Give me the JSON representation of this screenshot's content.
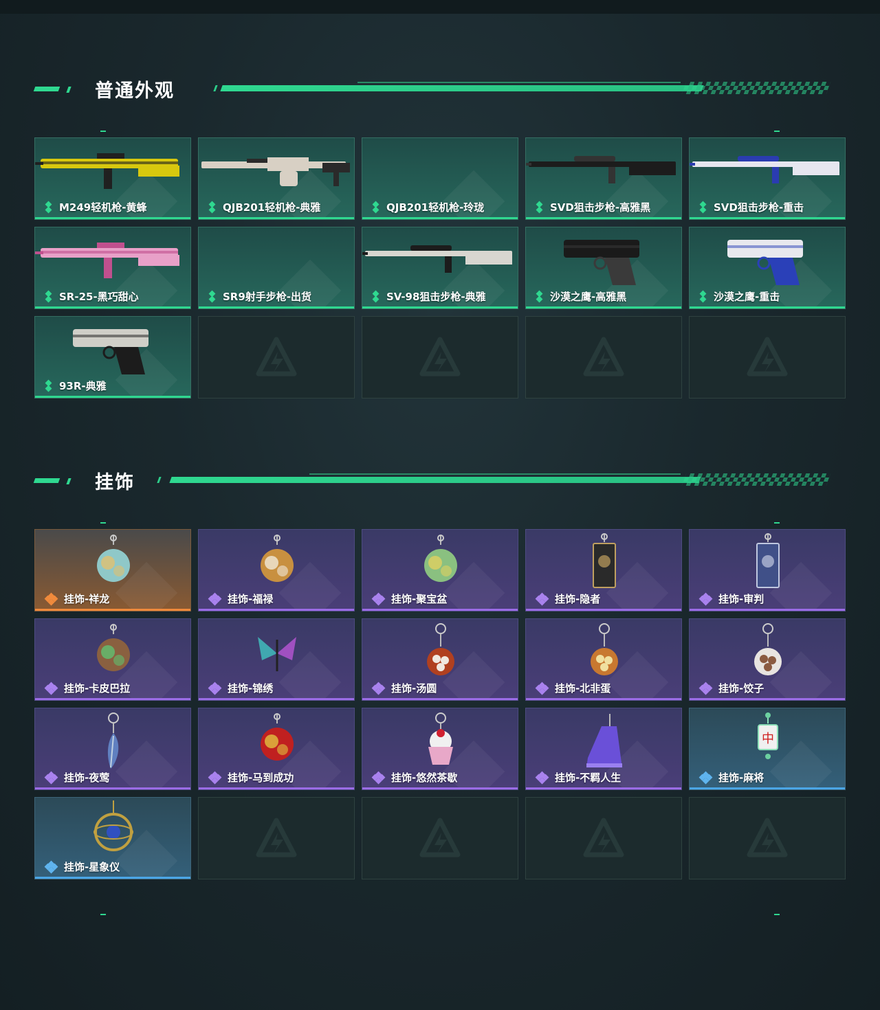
{
  "sections": [
    {
      "title": "普通外观",
      "items": [
        {
          "label": "M249轻机枪-黄蜂",
          "rarity": "green",
          "art": "rifle",
          "colors": [
            "#d8c80e",
            "#202020"
          ]
        },
        {
          "label": "QJB201轻机枪-典雅",
          "rarity": "green",
          "art": "lmg",
          "colors": [
            "#d8d0c4",
            "#2a2a2a"
          ]
        },
        {
          "label": "QJB201轻机枪-玲珑",
          "rarity": "green",
          "art": "none",
          "colors": []
        },
        {
          "label": "SVD狙击步枪-高雅黑",
          "rarity": "green",
          "art": "sniper",
          "colors": [
            "#1c1c1c",
            "#333333"
          ]
        },
        {
          "label": "SVD狙击步枪-重击",
          "rarity": "green",
          "art": "sniper",
          "colors": [
            "#e6e6ef",
            "#2a3cb0"
          ]
        },
        {
          "label": "SR-25-黑巧甜心",
          "rarity": "green",
          "art": "rifle",
          "colors": [
            "#e8a0c8",
            "#c0508e"
          ]
        },
        {
          "label": "SR9射手步枪-出货",
          "rarity": "green",
          "art": "none",
          "colors": []
        },
        {
          "label": "SV-98狙击步枪-典雅",
          "rarity": "green",
          "art": "sniper",
          "colors": [
            "#d8d6d0",
            "#1c1c1c"
          ]
        },
        {
          "label": "沙漠之鹰-高雅黑",
          "rarity": "green",
          "art": "pistol",
          "colors": [
            "#1a1a1a",
            "#3a3a3a"
          ]
        },
        {
          "label": "沙漠之鹰-重击",
          "rarity": "green",
          "art": "pistol",
          "colors": [
            "#e8e8ee",
            "#2a40b8"
          ]
        },
        {
          "label": "93R-典雅",
          "rarity": "green",
          "art": "pistol",
          "colors": [
            "#d0cfc8",
            "#1c1c1c"
          ]
        }
      ]
    },
    {
      "title": "挂饰",
      "items": [
        {
          "label": "挂饰-祥龙",
          "rarity": "orange",
          "art": "charm",
          "colors": [
            "#8fc8c8",
            "#e0c070"
          ]
        },
        {
          "label": "挂饰-福禄",
          "rarity": "purple",
          "art": "charm",
          "colors": [
            "#c89040",
            "#f0e8d8"
          ]
        },
        {
          "label": "挂饰-聚宝盆",
          "rarity": "purple",
          "art": "charm",
          "colors": [
            "#8ac080",
            "#e0d060"
          ]
        },
        {
          "label": "挂饰-隐者",
          "rarity": "purple",
          "art": "card",
          "colors": [
            "#2a2a2a",
            "#c0a060"
          ]
        },
        {
          "label": "挂饰-审判",
          "rarity": "purple",
          "art": "card",
          "colors": [
            "#405088",
            "#c0c8e0"
          ]
        },
        {
          "label": "挂饰-卡皮巴拉",
          "rarity": "purple",
          "art": "charm",
          "colors": [
            "#8a6040",
            "#60c070"
          ]
        },
        {
          "label": "挂饰-锦绣",
          "rarity": "purple",
          "art": "butterfly",
          "colors": [
            "#40a8b0",
            "#a050c0"
          ]
        },
        {
          "label": "挂饰-汤圆",
          "rarity": "purple",
          "art": "bowl",
          "colors": [
            "#b04020",
            "#f0e8e0"
          ]
        },
        {
          "label": "挂饰-北非蛋",
          "rarity": "purple",
          "art": "bowl",
          "colors": [
            "#c87830",
            "#f0e0a0"
          ]
        },
        {
          "label": "挂饰-饺子",
          "rarity": "purple",
          "art": "bowl",
          "colors": [
            "#e8e4e0",
            "#8a5a40"
          ]
        },
        {
          "label": "挂饰-夜莺",
          "rarity": "purple",
          "art": "feather",
          "colors": [
            "#6080c0",
            "#c0d0e0"
          ]
        },
        {
          "label": "挂饰-马到成功",
          "rarity": "purple",
          "art": "charm",
          "colors": [
            "#c02020",
            "#e0c040"
          ]
        },
        {
          "label": "挂饰-悠然茶歇",
          "rarity": "purple",
          "art": "cupcake",
          "colors": [
            "#e8a8c8",
            "#f0f0f0"
          ]
        },
        {
          "label": "挂饰-不羁人生",
          "rarity": "purple",
          "art": "shoe",
          "colors": [
            "#6a50d8",
            "#9a80f0"
          ]
        },
        {
          "label": "挂饰-麻将",
          "rarity": "blue",
          "art": "mahjong",
          "colors": [
            "#f0f0f0",
            "#d02020"
          ]
        },
        {
          "label": "挂饰-星象仪",
          "rarity": "blue",
          "art": "astro",
          "colors": [
            "#c0a040",
            "#3050c0"
          ]
        }
      ]
    }
  ]
}
